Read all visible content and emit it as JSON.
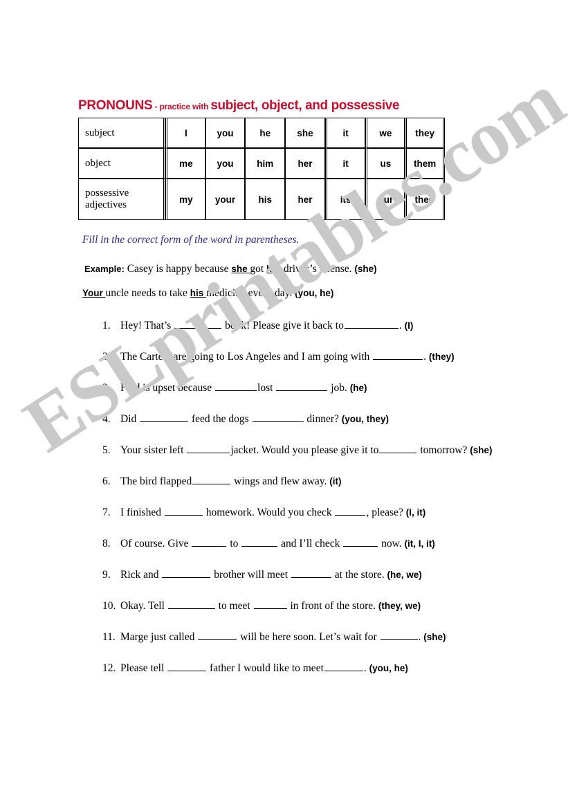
{
  "header": {
    "title_main": "PRONOUNS",
    "title_mid": " - practice with ",
    "title_tail": "subject, object, and possessive",
    "title_color": "#c8102e"
  },
  "pronoun_table": {
    "rows": [
      {
        "label": "subject",
        "cells": [
          "I",
          "you",
          "he",
          "she",
          "it",
          "we",
          "they"
        ]
      },
      {
        "label": "object",
        "cells": [
          "me",
          "you",
          "him",
          "her",
          "it",
          "us",
          "them"
        ]
      },
      {
        "label": "possessive\nadjectives",
        "label_line1": "possessive",
        "label_line2": "adjectives",
        "cells": [
          "my",
          "your",
          "his",
          "her",
          "its",
          "our",
          "their"
        ]
      }
    ]
  },
  "instruction": "Fill in the correct form of the word in parentheses.",
  "example": {
    "label": "Example:",
    "before_1": " Casey is happy because ",
    "answer_1": "she ",
    "between": "got ",
    "answer_2": "her ",
    "after": "driver’s license. ",
    "cue": "(she)"
  },
  "practice": {
    "answer_1": "Your ",
    "mid_1": "uncle needs to take ",
    "answer_2": "his ",
    "mid_2": "medicine every day. ",
    "cue": "(you, he)"
  },
  "questions": [
    {
      "num": "1.",
      "parts": [
        "Hey! That’s ",
        "BLANK:68",
        " book! Please give it back to",
        "BLANK:78",
        ". "
      ],
      "cue": "(I)"
    },
    {
      "num": "2.",
      "parts": [
        "The Carters are going to Los Angeles and I am going with ",
        "BLANK:72",
        ". "
      ],
      "cue": "(they)"
    },
    {
      "num": "3.",
      "parts": [
        "Fred is upset because ",
        "BLANK:60",
        "lost ",
        "BLANK:74",
        " job. "
      ],
      "cue": "(he)"
    },
    {
      "num": "4.",
      "parts": [
        "Did ",
        "BLANK:70",
        " feed the dogs ",
        "BLANK:74",
        " dinner? "
      ],
      "cue": "(you, they)"
    },
    {
      "num": "5.",
      "parts": [
        "Your sister left ",
        "BLANK:62",
        "jacket. Would you please give it to",
        "BLANK:54",
        " tomorrow? "
      ],
      "cue": "(she)"
    },
    {
      "num": "6.",
      "parts": [
        "The bird flapped",
        "BLANK:55",
        " wings and flew away. "
      ],
      "cue": "(it)"
    },
    {
      "num": "7.",
      "parts": [
        "I finished ",
        "BLANK:55",
        " homework. Would you check ",
        "BLANK:44",
        ", please? "
      ],
      "cue": "(I, it)"
    },
    {
      "num": "8.",
      "parts": [
        "Of course. Give ",
        "BLANK:50",
        " to ",
        "BLANK:52",
        " and I’ll check ",
        "BLANK:50",
        " now. "
      ],
      "cue": "(it, I, it)"
    },
    {
      "num": "9.",
      "parts": [
        "Rick and ",
        "BLANK:70",
        " brother will meet ",
        "BLANK:58",
        " at the store. "
      ],
      "cue": "(he, we)"
    },
    {
      "num": "10.",
      "parts": [
        "Okay. Tell ",
        "BLANK:68",
        " to meet ",
        "BLANK:48",
        " in front of the store. "
      ],
      "cue": "(they, we)"
    },
    {
      "num": "11.",
      "parts": [
        "Marge just called ",
        "BLANK:56",
        " will be here soon. Let’s wait for ",
        "BLANK:54",
        ". "
      ],
      "cue": "(she)"
    },
    {
      "num": "12.",
      "parts": [
        "Please tell ",
        "BLANK:56",
        " father I would like to meet",
        "BLANK:56",
        ". "
      ],
      "cue": "(you, he)"
    }
  ],
  "watermark": {
    "text": "ESLprintables.com",
    "color": "#c9c9c9"
  }
}
